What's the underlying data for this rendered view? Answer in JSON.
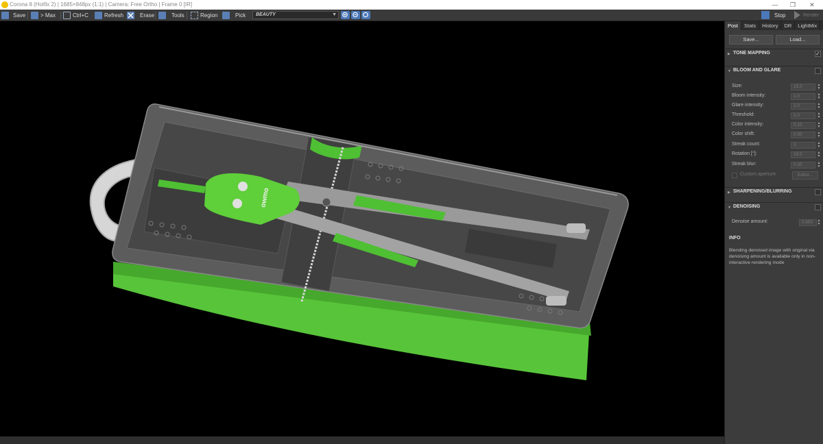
{
  "window": {
    "title": "Corona 8 (Hotfix 2) | 1685×848px (1:1) | Camera: Free Ortho | Frame 0 [IR]",
    "minimize": "—",
    "maximize": "❐",
    "close": "✕"
  },
  "toolbar": {
    "save": "Save",
    "max": "> Max",
    "copy": "Ctrl+C",
    "refresh": "Refresh",
    "erase": "Erase",
    "tools": "Tools",
    "region": "Region",
    "pick": "Pick",
    "pass": "BEAUTY",
    "stop": "Stop",
    "render": "Render"
  },
  "panel": {
    "tabs": [
      "Post",
      "Stats",
      "History",
      "DR",
      "LightMix"
    ],
    "active_tab": "Post",
    "save_btn": "Save...",
    "load_btn": "Load...",
    "sections": {
      "tone_mapping": "TONE MAPPING",
      "bloom_glare": "BLOOM AND GLARE",
      "sharpening": "SHARPENING/BLURRING",
      "denoising": "DENOISING"
    },
    "bloom_rows": [
      {
        "label": "Size:",
        "value": "15.0"
      },
      {
        "label": "Bloom intensity:",
        "value": "1.0"
      },
      {
        "label": "Glare intensity:",
        "value": "1.0"
      },
      {
        "label": "Threshold:",
        "value": "1.0"
      },
      {
        "label": "Color intensity:",
        "value": "0.10"
      },
      {
        "label": "Color shift:",
        "value": "0.50"
      },
      {
        "label": "Streak count:",
        "value": "3"
      },
      {
        "label": "Rotation [°]:",
        "value": "15.0"
      },
      {
        "label": "Streak blur:",
        "value": "0.20"
      }
    ],
    "custom_aperture": "Custom aperture",
    "editor_btn": "Editor...",
    "denoise_label": "Denoise amount:",
    "denoise_value": "0.650",
    "info_title": "INFO",
    "info_text": "Blending denoised image with original via denoising amount is available only in non-interactive rendering mode"
  },
  "render": {
    "logo_text": "owmo"
  },
  "colors": {
    "accent_blue": "#4b78b8",
    "product_green": "#5fcf3a",
    "viewport_bg": "#000000"
  }
}
